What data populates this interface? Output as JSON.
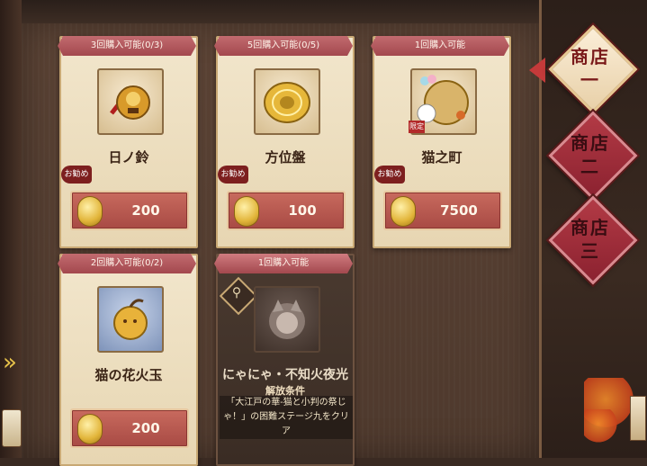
{
  "shop_tabs": [
    {
      "label": "商店一",
      "active": true
    },
    {
      "label": "商店二",
      "active": false
    },
    {
      "label": "商店三",
      "active": false
    }
  ],
  "items": [
    {
      "header": "3回購入可能(0/3)",
      "name": "日ノ鈴",
      "badge": "お勧め",
      "price": "200",
      "icon": "bell-icon"
    },
    {
      "header": "5回購入可能(0/5)",
      "name": "方位盤",
      "badge": "お勧め",
      "price": "100",
      "icon": "compass-icon"
    },
    {
      "header": "1回購入可能",
      "name": "猫之町",
      "badge": "お勧め",
      "price": "7500",
      "icon": "lucky-cat-icon",
      "limited": "限定"
    },
    {
      "header": "2回購入可能(0/2)",
      "name": "猫の花火玉",
      "price": "200",
      "icon": "firework-ball-icon"
    },
    {
      "header": "1回購入可能",
      "name": "にゃにゃ・不知火夜光",
      "icon": "character-portrait-icon",
      "locked": true,
      "unlock_title": "解放条件",
      "unlock_text": "「大江戸の華-猫と小判の祭じゃ！」の困難ステージ九をクリア"
    }
  ],
  "colors": {
    "accent_red": "#a3484e",
    "gold": "#e2b53a",
    "card_bg": "#f2e6cc"
  }
}
